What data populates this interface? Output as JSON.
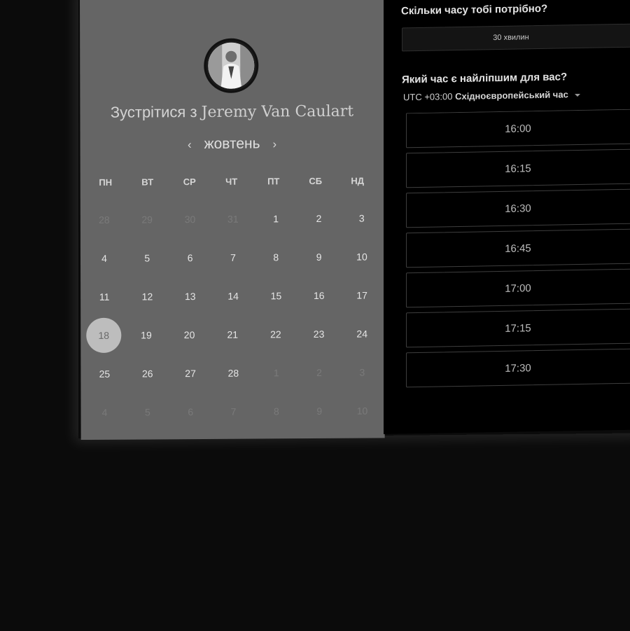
{
  "left": {
    "headline_prefix": "Зустрітися з",
    "host_name": "Jeremy Van Caulart",
    "month": "жовтень",
    "prev_icon": "‹",
    "next_icon": "›",
    "weekdays": [
      "ПН",
      "ВТ",
      "СР",
      "ЧТ",
      "ПТ",
      "СБ",
      "НД"
    ],
    "weeks": [
      [
        {
          "d": "28",
          "muted": true
        },
        {
          "d": "29",
          "muted": true
        },
        {
          "d": "30",
          "muted": true
        },
        {
          "d": "31",
          "muted": true
        },
        {
          "d": "1"
        },
        {
          "d": "2"
        },
        {
          "d": "3"
        }
      ],
      [
        {
          "d": "4"
        },
        {
          "d": "5"
        },
        {
          "d": "6"
        },
        {
          "d": "7"
        },
        {
          "d": "8"
        },
        {
          "d": "9"
        },
        {
          "d": "10"
        }
      ],
      [
        {
          "d": "11"
        },
        {
          "d": "12"
        },
        {
          "d": "13"
        },
        {
          "d": "14"
        },
        {
          "d": "15"
        },
        {
          "d": "16"
        },
        {
          "d": "17"
        }
      ],
      [
        {
          "d": "18",
          "selected": true
        },
        {
          "d": "19"
        },
        {
          "d": "20"
        },
        {
          "d": "21"
        },
        {
          "d": "22"
        },
        {
          "d": "23"
        },
        {
          "d": "24"
        }
      ],
      [
        {
          "d": "25"
        },
        {
          "d": "26"
        },
        {
          "d": "27"
        },
        {
          "d": "28"
        },
        {
          "d": "1",
          "muted": true
        },
        {
          "d": "2",
          "muted": true
        },
        {
          "d": "3",
          "muted": true
        }
      ],
      [
        {
          "d": "4",
          "muted": true
        },
        {
          "d": "5",
          "muted": true
        },
        {
          "d": "6",
          "muted": true
        },
        {
          "d": "7",
          "muted": true
        },
        {
          "d": "8",
          "muted": true
        },
        {
          "d": "9",
          "muted": true
        },
        {
          "d": "10",
          "muted": true
        }
      ]
    ]
  },
  "right": {
    "duration_question": "Скільки часу тобі потрібно?",
    "duration_value": "30 хвилин",
    "time_question": "Який час є найліпшим для вас?",
    "tz_offset": "UTC +03:00",
    "tz_name": "Східноєвропейський час",
    "slots": [
      "16:00",
      "16:15",
      "16:30",
      "16:45",
      "17:00",
      "17:15",
      "17:30",
      ""
    ]
  },
  "colors": {
    "left_panel_bg": "#656565",
    "right_panel_bg": "#000000",
    "selected_day_bg": "#bdbdbd"
  }
}
